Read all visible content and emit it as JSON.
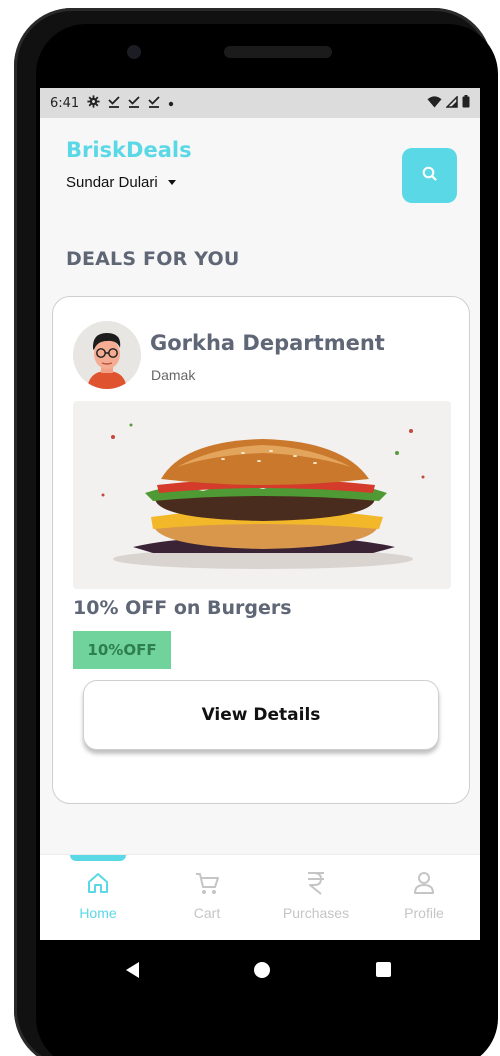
{
  "status_bar": {
    "time": "6:41",
    "left_icons": [
      "gear-icon",
      "download-done-icon",
      "download-done-icon",
      "download-done-icon",
      "dot-icon"
    ],
    "right_icons": [
      "wifi-icon",
      "signal-icon",
      "battery-icon"
    ]
  },
  "header": {
    "brand": "BriskDeals",
    "user_name": "Sundar Dulari",
    "search_icon": "search-icon"
  },
  "section": {
    "title": "DEALS FOR YOU"
  },
  "deal": {
    "store_name": "Gorkha Department",
    "store_location": "Damak",
    "image": "burger-image",
    "title": "10% OFF on Burgers",
    "badge": "10%OFF",
    "button_label": "View Details"
  },
  "bottom_nav": {
    "active": "Home",
    "items": [
      {
        "label": "Home",
        "icon": "home-icon"
      },
      {
        "label": "Cart",
        "icon": "cart-icon"
      },
      {
        "label": "Purchases",
        "icon": "rupee-icon"
      },
      {
        "label": "Profile",
        "icon": "profile-icon"
      }
    ]
  },
  "colors": {
    "accent": "#5ad8e6",
    "title_gray": "#5f6675",
    "badge_green": "#71d39c",
    "nav_inactive": "#c5c5c5"
  }
}
